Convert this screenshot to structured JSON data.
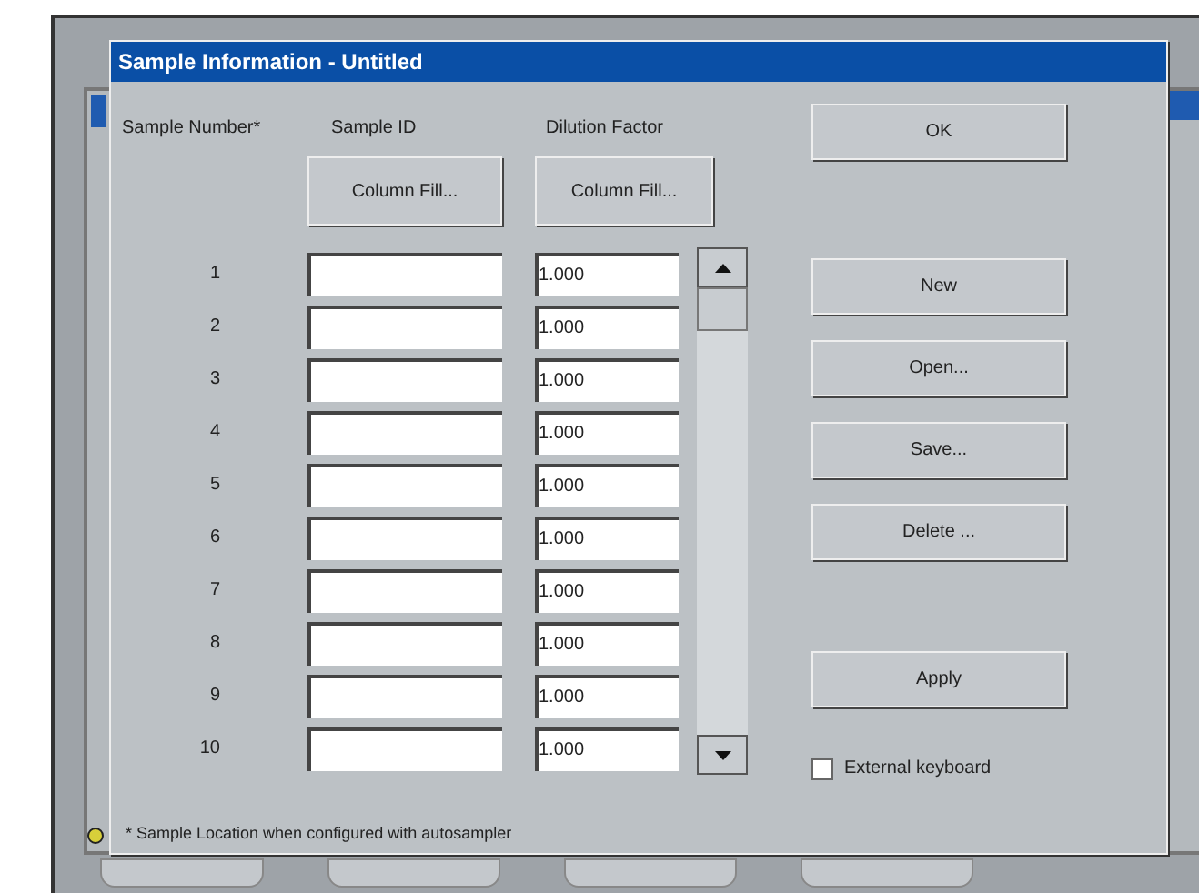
{
  "window": {
    "title": "Sample Information - Untitled"
  },
  "columns": [
    "Sample Number*",
    "Sample ID",
    "Dilution Factor"
  ],
  "column_fill_buttons": [
    "Column Fill...",
    "Column Fill..."
  ],
  "rows": [
    {
      "number": "1",
      "sample_id": "",
      "dilution": "1.000"
    },
    {
      "number": "2",
      "sample_id": "",
      "dilution": "1.000"
    },
    {
      "number": "3",
      "sample_id": "",
      "dilution": "1.000"
    },
    {
      "number": "4",
      "sample_id": "",
      "dilution": "1.000"
    },
    {
      "number": "5",
      "sample_id": "",
      "dilution": "1.000"
    },
    {
      "number": "6",
      "sample_id": "",
      "dilution": "1.000"
    },
    {
      "number": "7",
      "sample_id": "",
      "dilution": "1.000"
    },
    {
      "number": "8",
      "sample_id": "",
      "dilution": "1.000"
    },
    {
      "number": "9",
      "sample_id": "",
      "dilution": "1.000"
    },
    {
      "number": "10",
      "sample_id": "",
      "dilution": "1.000"
    }
  ],
  "ok_button": "OK",
  "file_buttons": [
    "New",
    "Open...",
    "Save...",
    "Delete ..."
  ],
  "apply_button": "Apply",
  "external_keyboard": {
    "label": "External keyboard",
    "checked": false
  },
  "footnote": "* Sample Location when configured with autosampler"
}
